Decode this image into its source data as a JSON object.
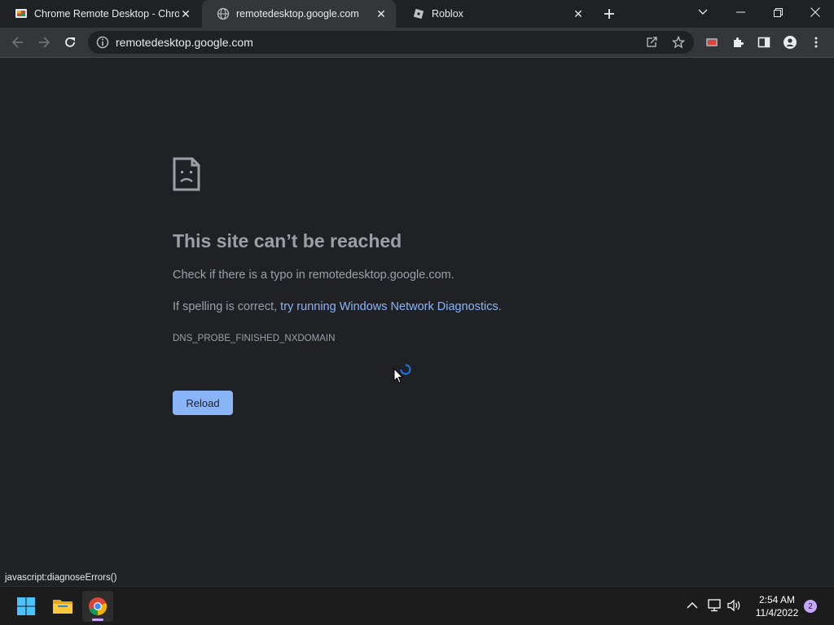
{
  "tabs": [
    {
      "title": "Chrome Remote Desktop - Chrom",
      "icon": "chrome-remote-desktop-icon",
      "active": false
    },
    {
      "title": "remotedesktop.google.com",
      "icon": "globe-icon",
      "active": true
    },
    {
      "title": "Roblox",
      "icon": "roblox-icon",
      "active": false
    }
  ],
  "toolbar": {
    "url": "remotedesktop.google.com"
  },
  "error": {
    "title": "This site can’t be reached",
    "line1": "Check if there is a typo in remotedesktop.google.com.",
    "line2_prefix": "If spelling is correct, ",
    "line2_link": "try running Windows Network Diagnostics",
    "line2_suffix": ".",
    "code": "DNS_PROBE_FINISHED_NXDOMAIN",
    "reload_label": "Reload"
  },
  "statusbar": {
    "text": "javascript:diagnoseErrors()"
  },
  "taskbar": {
    "time": "2:54 AM",
    "date": "11/4/2022",
    "notifications": "2"
  },
  "colors": {
    "background": "#202124",
    "toolbar": "#35363a",
    "link": "#8ab4f8",
    "button": "#8ab4f8",
    "text": "#9aa0a6"
  }
}
